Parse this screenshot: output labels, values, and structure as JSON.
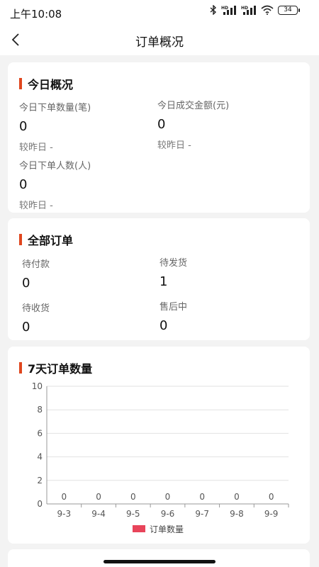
{
  "status_bar": {
    "time": "上午10:08",
    "battery": "34"
  },
  "nav": {
    "title": "订单概况",
    "back_icon": "chevron-left-icon"
  },
  "today_overview": {
    "title": "今日概况",
    "orders_label": "今日下单数量(笔)",
    "orders_value": "0",
    "orders_compare": "较昨日 -",
    "amount_label": "今日成交金额(元)",
    "amount_value": "0",
    "amount_compare": "较昨日 -",
    "buyers_label": "今日下单人数(人)",
    "buyers_value": "0",
    "buyers_compare": "较昨日 -"
  },
  "all_orders": {
    "title": "全部订单",
    "pending_payment_label": "待付款",
    "pending_payment_value": "0",
    "pending_shipment_label": "待发货",
    "pending_shipment_value": "1",
    "pending_receipt_label": "待收货",
    "pending_receipt_value": "0",
    "after_sales_label": "售后中",
    "after_sales_value": "0"
  },
  "colors": {
    "accent": "#e0471f",
    "series": "#e8445a"
  },
  "chart_data": {
    "type": "bar",
    "title": "7天订单数量",
    "categories": [
      "9-3",
      "9-4",
      "9-5",
      "9-6",
      "9-7",
      "9-8",
      "9-9"
    ],
    "series": [
      {
        "name": "订单数量",
        "values": [
          0,
          0,
          0,
          0,
          0,
          0,
          0
        ]
      }
    ],
    "yticks": [
      0,
      2,
      4,
      6,
      8,
      10
    ],
    "ylim": [
      0,
      10
    ],
    "grid": true,
    "legend": "bottom-center"
  }
}
